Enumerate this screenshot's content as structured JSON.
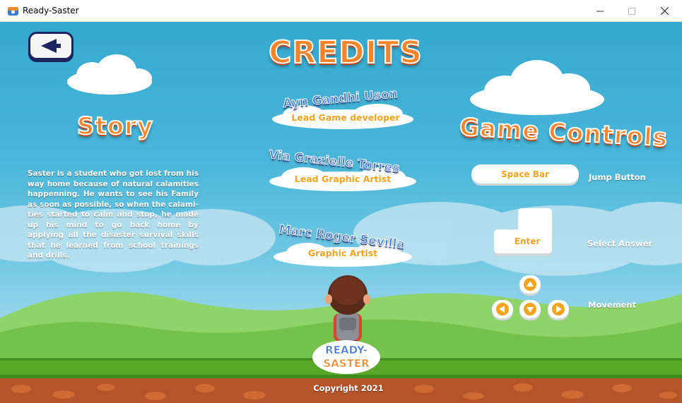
{
  "window": {
    "title": "Ready-Saster",
    "icon": "app-icon",
    "minimize_icon": "minimize-icon",
    "maximize_icon": "maximize-icon",
    "close_icon": "close-icon"
  },
  "header": {
    "title": "CREDITS",
    "back_icon": "back-arrow-icon"
  },
  "story": {
    "title": "Story",
    "text": "Saster is a student who got lost from his way home because of natural calamities happenning. He wants to see his Family as soon as possible, so when the calami-ties started to calm and stop, he made up his mind to go back home by applying all the disaster survival skills that he learned from school trainings and drills."
  },
  "credits": [
    {
      "name": "Ayn Gandhi Uson",
      "role": "Lead Game developer"
    },
    {
      "name": "Via Grazielle Torres",
      "role": "Lead Graphic Artist"
    },
    {
      "name": "Marc Roger Sevilla",
      "role": "Graphic Artist"
    }
  ],
  "controls": {
    "title": "Game Controls",
    "jump": {
      "key": "Space Bar",
      "label": "Jump Button"
    },
    "select": {
      "key": "Enter",
      "label": "Select Answer"
    },
    "movement": {
      "label": "Movement",
      "icons": [
        "arrow-up-icon",
        "arrow-left-icon",
        "arrow-down-icon",
        "arrow-right-icon"
      ]
    }
  },
  "footer": {
    "logo_line1": "READY-",
    "logo_line2": "SASTER",
    "copyright": "Copyright 2021"
  },
  "colors": {
    "sky": "#49b6d9",
    "title_orange": "#f3842a",
    "credit_blue": "#3f78d8",
    "role_gold": "#f3a31d",
    "grass": "#5aa82a",
    "soil": "#b5532a",
    "back_border": "#1c2560"
  }
}
